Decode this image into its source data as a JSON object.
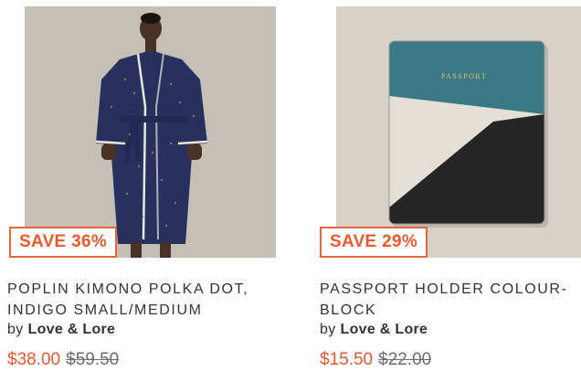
{
  "products": [
    {
      "badge": "SAVE 36%",
      "title": "POPLIN KIMONO POLKA DOT, INDIGO SMALL/MEDIUM",
      "by_label": "by",
      "brand": "Love & Lore",
      "sale_price": "$38.00",
      "original_price": "$59.50",
      "image_icon": "kimono-robe-photo",
      "colors": {
        "robe": "#2a3462",
        "background": "#c7c2ba"
      }
    },
    {
      "badge": "SAVE 29%",
      "title": "PASSPORT HOLDER COLOUR-BLOCK",
      "by_label": "by",
      "brand": "Love & Lore",
      "sale_price": "$15.50",
      "original_price": "$22.00",
      "image_icon": "passport-holder-photo",
      "image_text": "PASSPORT",
      "colors": {
        "teal": "#3b7a84",
        "cream": "#e4e0d8",
        "black": "#262626",
        "background": "#d5d1c9"
      }
    }
  ],
  "accent_color": "#e85a30"
}
